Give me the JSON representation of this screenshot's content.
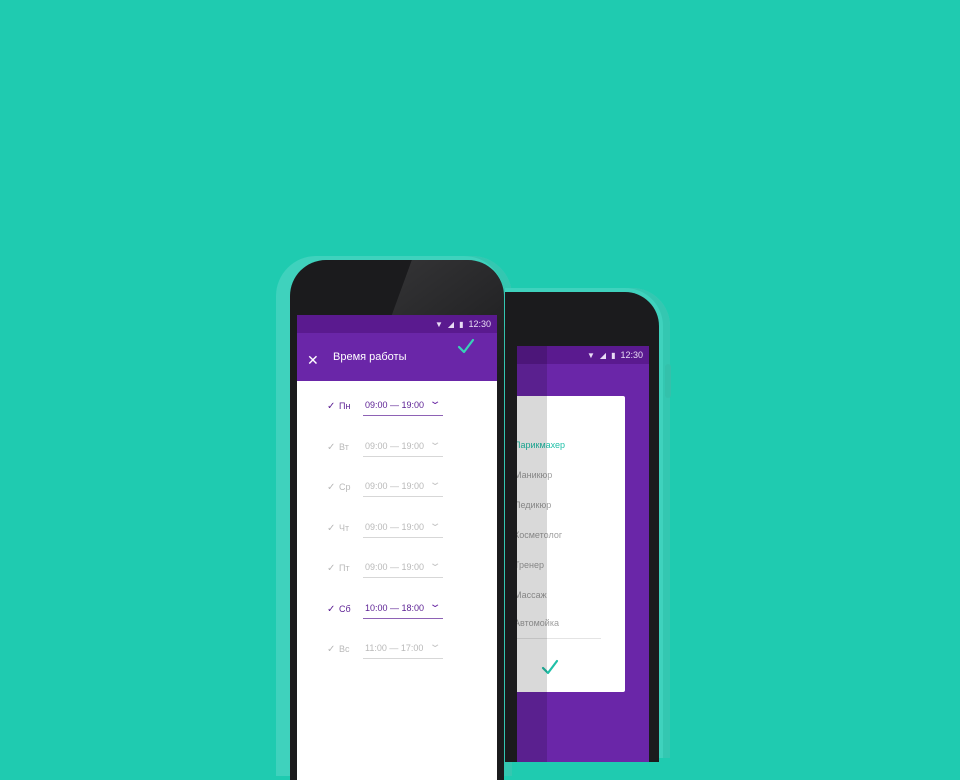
{
  "colors": {
    "background": "#1fcbb0",
    "brand_purple": "#6a26a8",
    "accent_teal": "#20c0a8"
  },
  "status_bar": {
    "time": "12:30"
  },
  "schedule": {
    "title": "Время работы",
    "close_icon": "close-icon",
    "confirm_icon": "check-icon",
    "days": [
      {
        "day": "Пн",
        "time": "09:00 — 19:00",
        "enabled": true
      },
      {
        "day": "Вт",
        "time": "09:00 — 19:00",
        "enabled": false
      },
      {
        "day": "Ср",
        "time": "09:00 — 19:00",
        "enabled": false
      },
      {
        "day": "Чт",
        "time": "09:00 — 19:00",
        "enabled": false
      },
      {
        "day": "Пт",
        "time": "09:00 — 19:00",
        "enabled": false
      },
      {
        "day": "Сб",
        "time": "10:00 — 18:00",
        "enabled": true
      },
      {
        "day": "Вс",
        "time": "11:00 — 17:00",
        "enabled": false
      }
    ]
  },
  "categories": {
    "selected": "Парикмахер",
    "items": [
      "Парикмахер",
      "Маникюр",
      "Педикюр",
      "Косметолог",
      "Тренер",
      "Массаж",
      "Автомойка"
    ],
    "confirm_icon": "check-icon"
  }
}
